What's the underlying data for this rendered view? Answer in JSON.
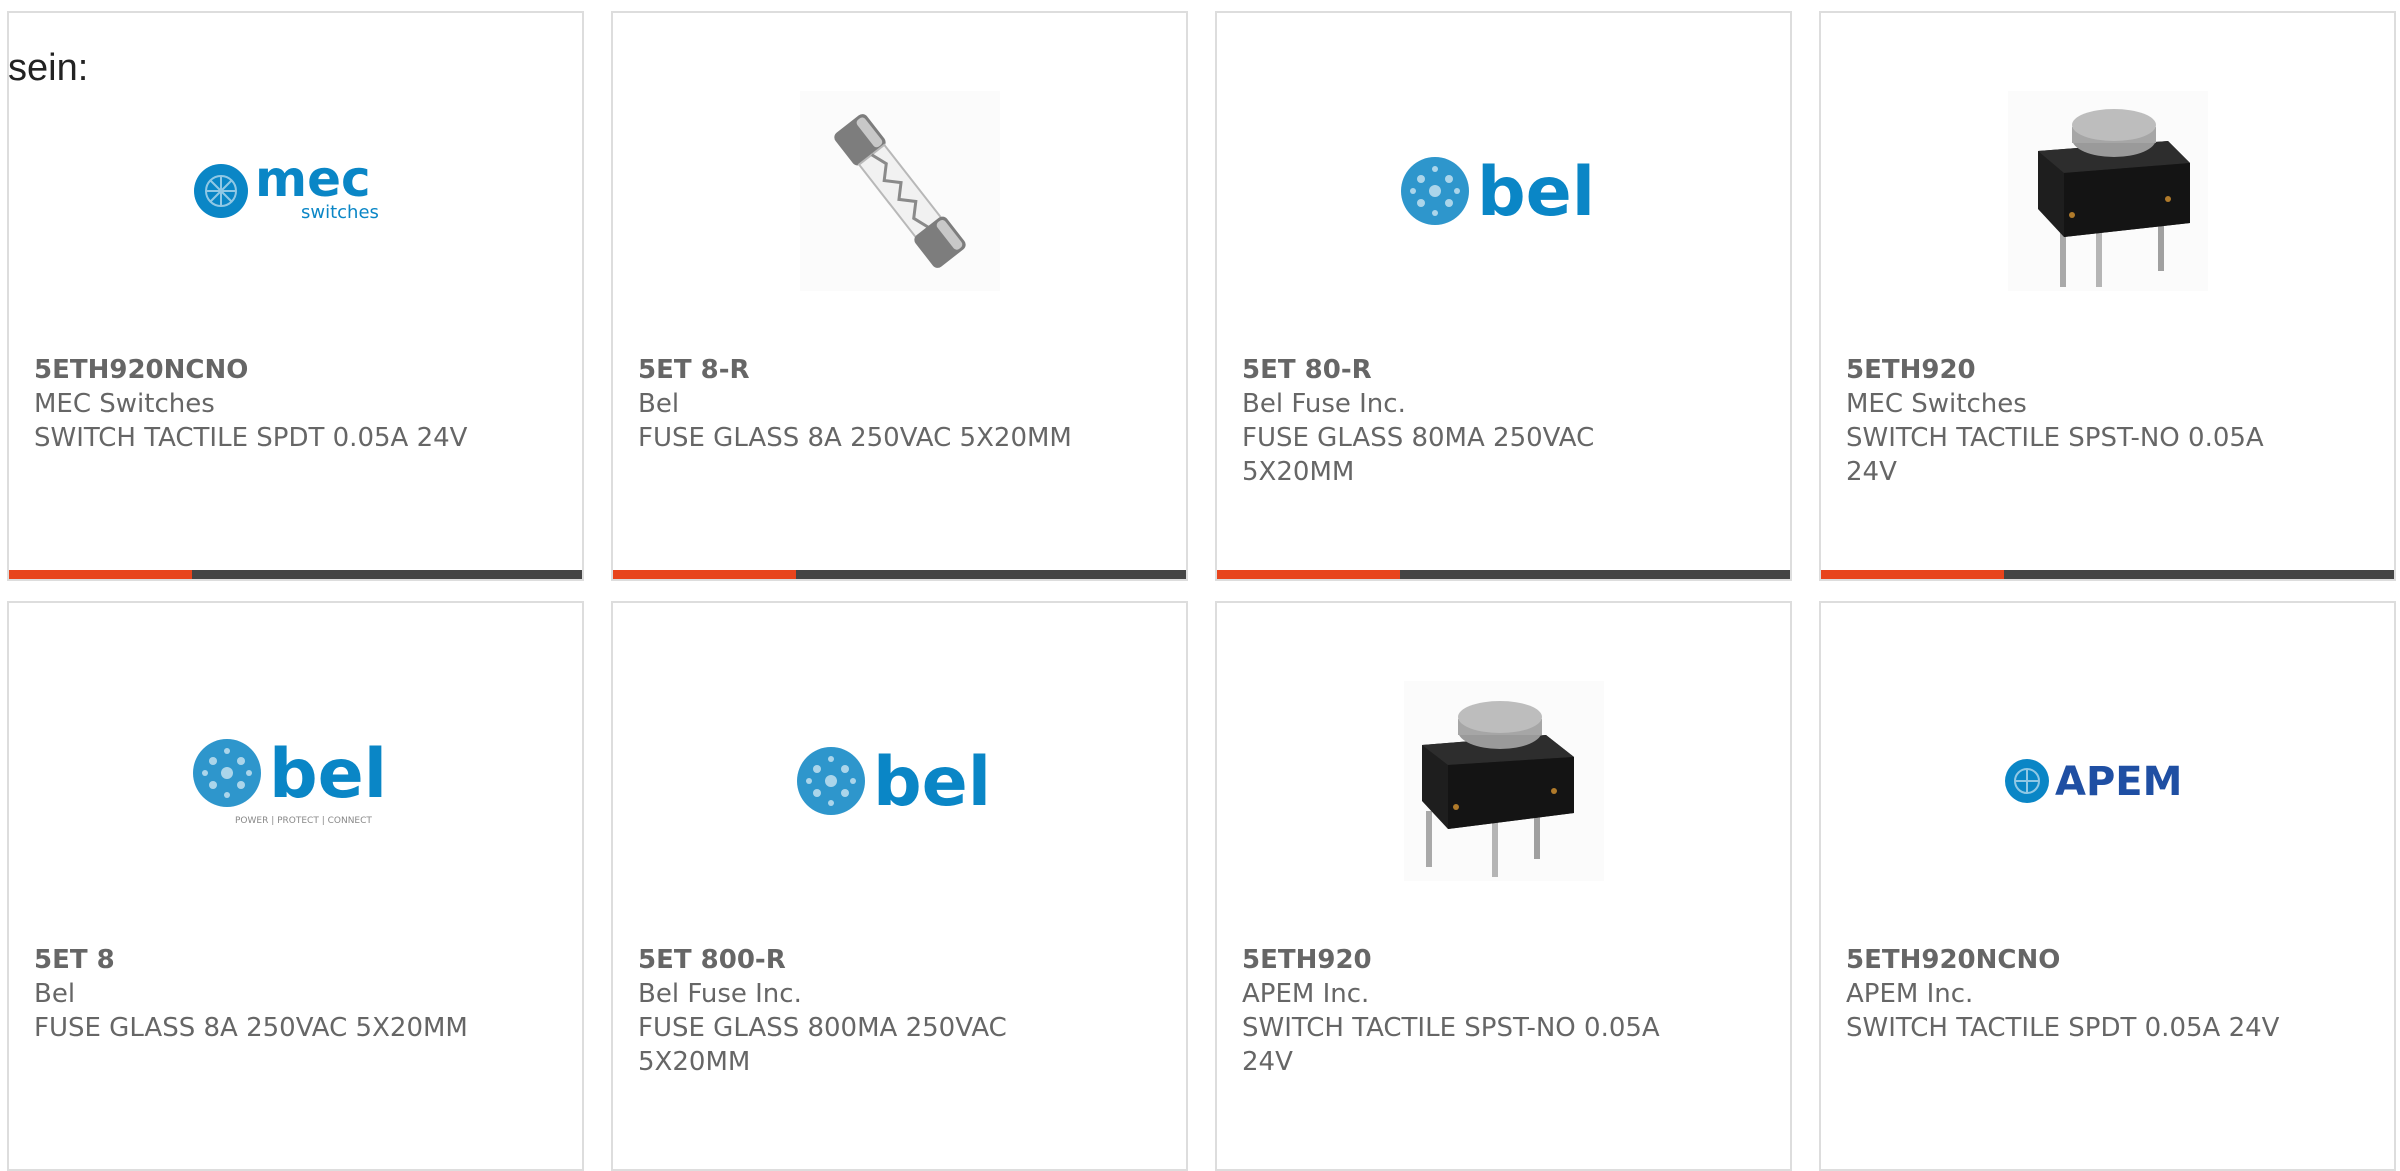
{
  "intro_text": "sein:",
  "colors": {
    "accent_bar": "#e8441c",
    "dark_bar": "#444444",
    "brand_blue": "#0a86c6",
    "text": "#666666"
  },
  "cards": [
    {
      "part_number": "5ETH920NCNO",
      "manufacturer": "MEC Switches",
      "description": "SWITCH TACTILE SPDT 0.05A 24V",
      "image": "mec-logo",
      "logo_text": "mec",
      "logo_subtext": "switches"
    },
    {
      "part_number": "5ET 8-R",
      "manufacturer": "Bel",
      "description": "FUSE GLASS 8A 250VAC 5X20MM",
      "image": "glass-fuse-photo"
    },
    {
      "part_number": "5ET 80-R",
      "manufacturer": "Bel Fuse Inc.",
      "description": "FUSE GLASS 80MA 250VAC 5X20MM",
      "image": "bel-logo",
      "logo_text": "bel"
    },
    {
      "part_number": "5ETH920",
      "manufacturer": "MEC Switches",
      "description": "SWITCH TACTILE SPST-NO 0.05A 24V",
      "image": "tactile-switch-photo"
    },
    {
      "part_number": "5ET 8",
      "manufacturer": "Bel",
      "description": "FUSE GLASS 8A 250VAC 5X20MM",
      "image": "bel-logo-tagline",
      "logo_text": "bel",
      "logo_subtext": "POWER | PROTECT | CONNECT"
    },
    {
      "part_number": "5ET 800-R",
      "manufacturer": "Bel Fuse Inc.",
      "description": "FUSE GLASS 800MA 250VAC 5X20MM",
      "image": "bel-logo",
      "logo_text": "bel"
    },
    {
      "part_number": "5ETH920",
      "manufacturer": "APEM Inc.",
      "description": "SWITCH TACTILE SPST-NO 0.05A 24V",
      "image": "tactile-switch-photo"
    },
    {
      "part_number": "5ETH920NCNO",
      "manufacturer": "APEM Inc.",
      "description": "SWITCH TACTILE SPDT 0.05A 24V",
      "image": "apem-logo",
      "logo_text": "APEM"
    }
  ]
}
